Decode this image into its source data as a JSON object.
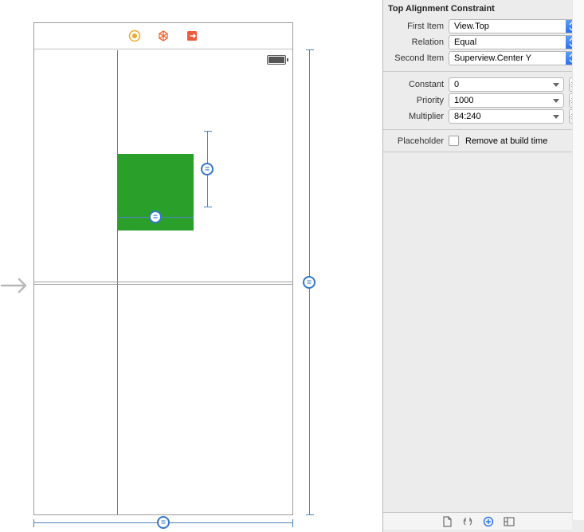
{
  "inspector": {
    "section_title": "Top Alignment Constraint",
    "first_item": {
      "label": "First Item",
      "value": "View.Top"
    },
    "relation": {
      "label": "Relation",
      "value": "Equal"
    },
    "second_item": {
      "label": "Second Item",
      "value": "Superview.Center Y"
    },
    "constant": {
      "label": "Constant",
      "value": "0"
    },
    "priority": {
      "label": "Priority",
      "value": "1000"
    },
    "multiplier": {
      "label": "Multiplier",
      "value": "84:240"
    },
    "placeholder": {
      "label": "Placeholder",
      "checkbox_label": "Remove at build time",
      "checked": false
    }
  },
  "canvas": {
    "constraint_badge_symbol": "="
  }
}
